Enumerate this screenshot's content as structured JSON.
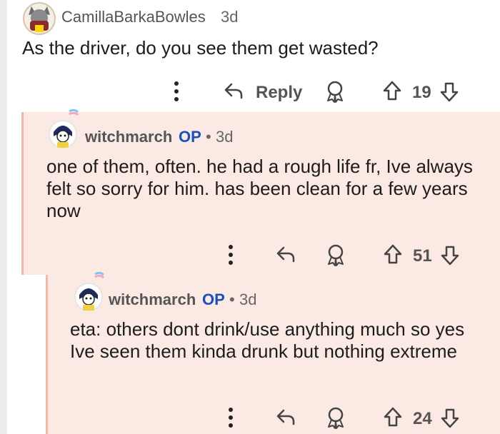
{
  "comments": [
    {
      "username": "CamillaBarkaBowles",
      "time": "3d",
      "text": "As the driver, do you see them get wasted?",
      "reply_label": "Reply",
      "votes": "19"
    },
    {
      "username": "witchmarch",
      "op_badge": "OP",
      "separator": "•",
      "time": "3d",
      "text": "one of them, often. he had a rough life fr, Ive always felt so sorry for him. has been clean for a few years now",
      "votes": "51"
    },
    {
      "username": "witchmarch",
      "op_badge": "OP",
      "separator": "•",
      "time": "3d",
      "text": "eta: others dont drink/use anything much so yes Ive seen them kinda drunk but nothing extreme",
      "votes": "24"
    }
  ],
  "colors": {
    "op": "#1a4fbf",
    "reply_bg": "#fbeae4",
    "reply_rail": "#f2b8a8"
  },
  "icons": [
    "more-icon",
    "reply-arrow-icon",
    "award-icon",
    "upvote-icon",
    "downvote-icon"
  ]
}
